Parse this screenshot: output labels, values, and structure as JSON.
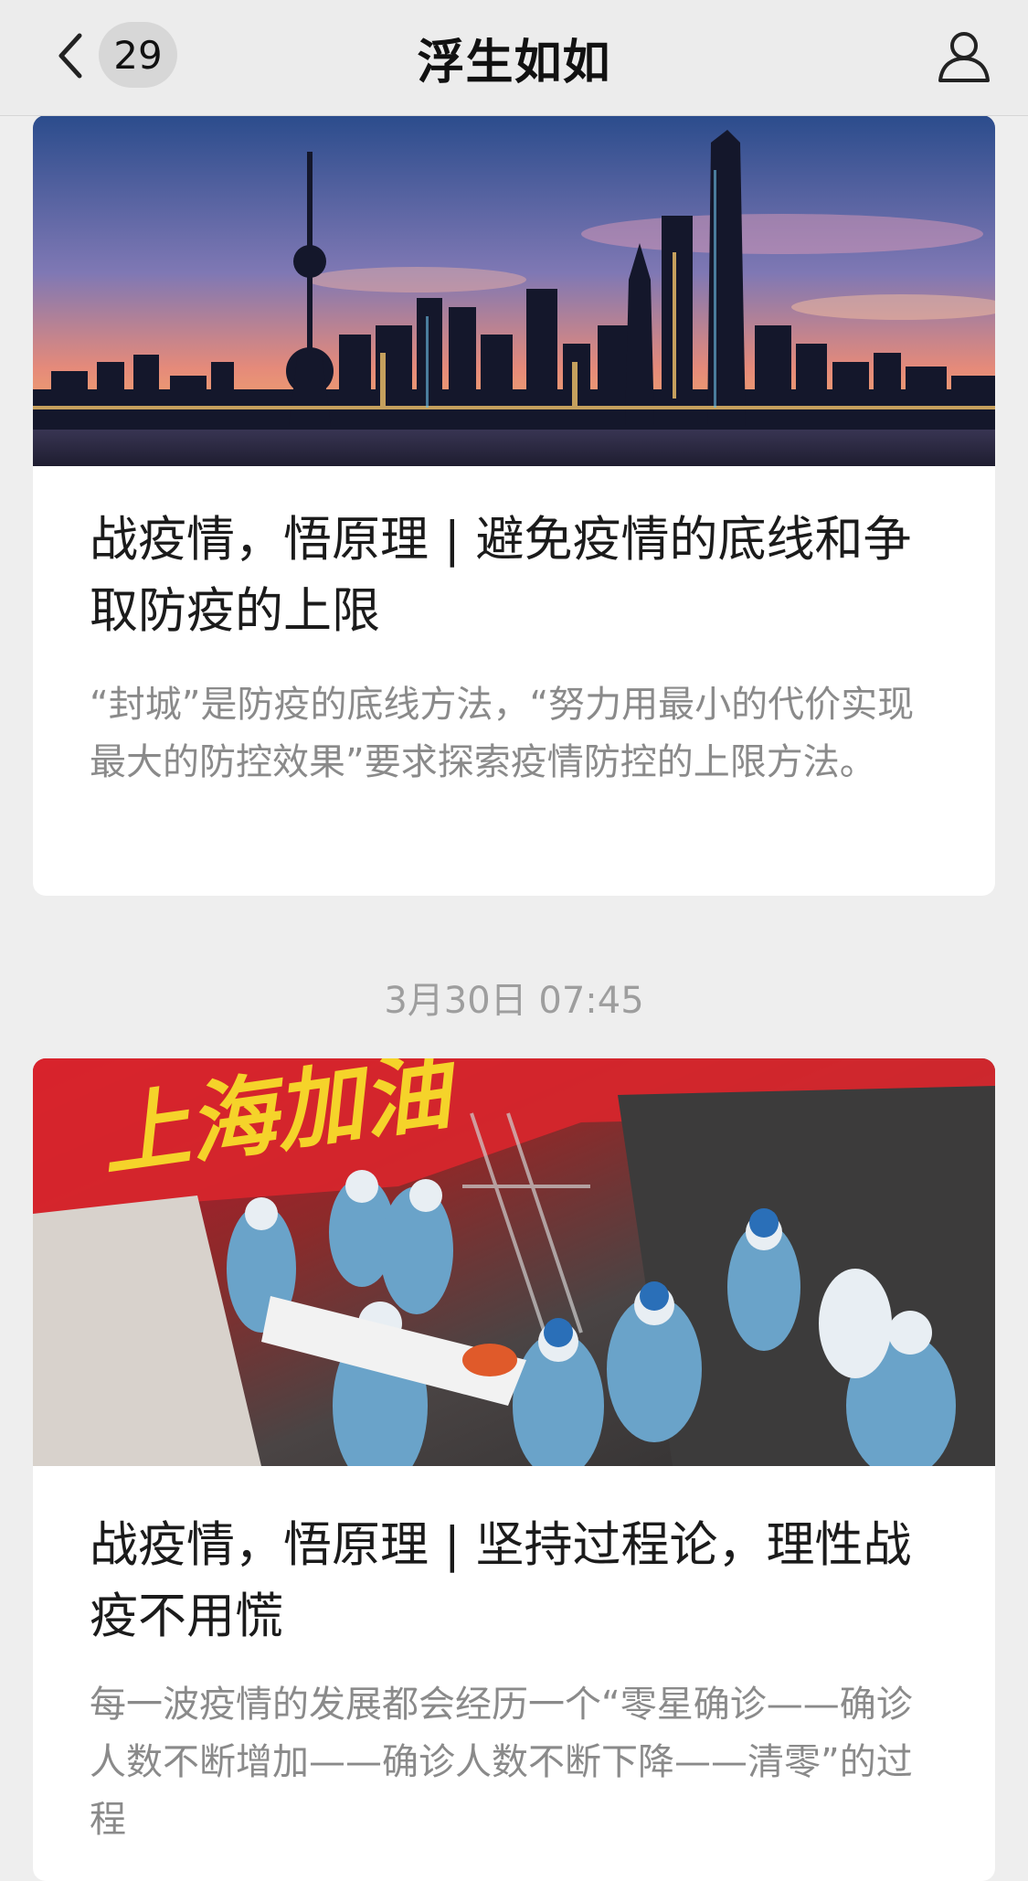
{
  "nav": {
    "back_icon": "chevron-left-icon",
    "unread_count": "29",
    "title": "浮生如如",
    "profile_icon": "person-icon"
  },
  "articles": [
    {
      "title": "战疫情，悟原理 | 避免疫情的底线和争取防疫的上限",
      "summary": "“封城”是防疫的底线方法，“努力用最小的代价实现最大的防控效果”要求探索疫情防控的上限方法。"
    },
    {
      "image_overlay_text": "上海加油",
      "title": "战疫情，悟原理 | 坚持过程论，理性战疫不用慌",
      "summary": "每一波疫情的发展都会经历一个“零星确诊——确诊人数不断增加——确诊人数不断下降——清零”的过程"
    }
  ],
  "timestamp": "3月30日 07:45",
  "colors": {
    "nav_bg": "#ececec",
    "page_bg": "#eeeeee",
    "card_bg": "#ffffff",
    "summary_text": "#8a8a8a",
    "banner_red": "#d9262c"
  }
}
